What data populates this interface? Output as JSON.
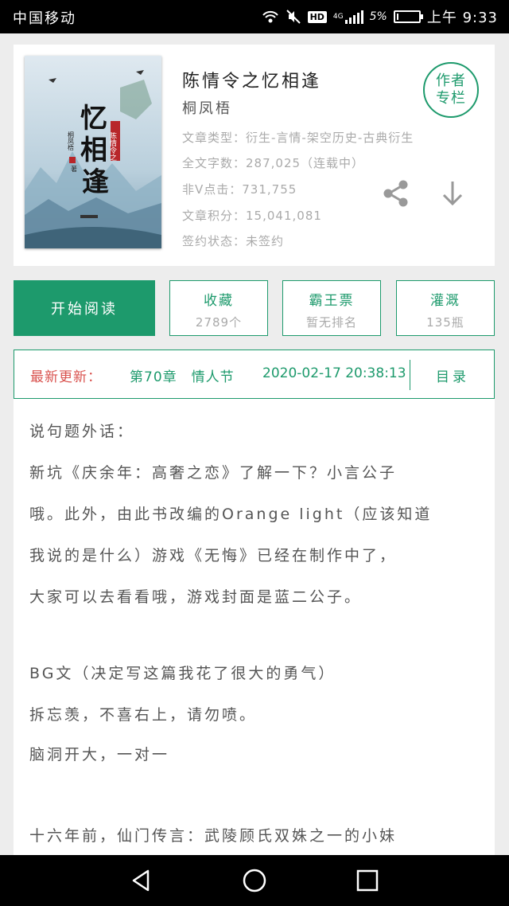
{
  "status_bar": {
    "carrier": "中国移动",
    "hd": "HD",
    "network": "4G",
    "battery": "5%",
    "battery_level": 0.05,
    "time": "上午 9:33"
  },
  "book": {
    "title": "陈情令之忆相逢",
    "author": "桐凤梧",
    "cover_text": {
      "title": "忆相逢",
      "series": "陈情令之",
      "author_sig": "桐凤梧",
      "author_mark": "著"
    },
    "meta": [
      {
        "label": "文章类型：",
        "value": "衍生-言情-架空历史-古典衍生"
      },
      {
        "label": "全文字数：",
        "value": "287,025（连载中）"
      },
      {
        "label": "非V点击：",
        "value": "731,755"
      },
      {
        "label": "文章积分：",
        "value": "15,041,081"
      },
      {
        "label": "签约状态：",
        "value": "未签约"
      }
    ],
    "author_column_line1": "作者",
    "author_column_line2": "专栏"
  },
  "actions": {
    "start_reading": "开始阅读",
    "favorite": {
      "label": "收藏",
      "value": "2789个"
    },
    "overlord_ticket": {
      "label": "霸王票",
      "value": "暂无排名"
    },
    "irrigate": {
      "label": "灌溉",
      "value": "135瓶"
    }
  },
  "latest_update": {
    "label": "最新更新：",
    "chapter": "第70章　情人节",
    "datetime": "2020-02-17 20:38:13",
    "toc": "目录"
  },
  "content_lines": [
    "说句题外话：",
    "新坑《庆余年：高奢之恋》了解一下？小言公子",
    "哦。此外，由此书改编的Orange light（应该知道",
    "我说的是什么）游戏《无悔》已经在制作中了，",
    "大家可以去看看哦，游戏封面是蓝二公子。",
    "",
    "BG文（决定写这篇我花了很大的勇气）",
    "拆忘羡，不喜右上，请勿喷。",
    "脑洞开大，一对一",
    "",
    "十六年前，仙门传言：武陵顾氏双姝之一的小妹"
  ],
  "colors": {
    "accent": "#1d9a6c",
    "highlight": "#d9534f",
    "muted": "#aaaaaa"
  },
  "icons": [
    "wifi-icon",
    "mute-icon",
    "signal-icon",
    "battery-icon",
    "share-icon",
    "download-icon",
    "back-icon",
    "home-icon",
    "recents-icon"
  ]
}
